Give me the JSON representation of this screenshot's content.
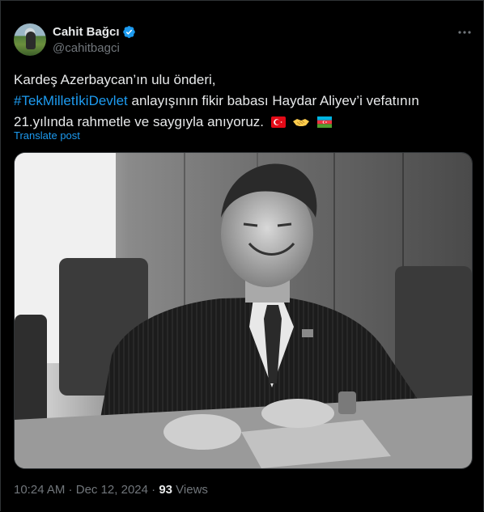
{
  "author": {
    "name": "Cahit Bağcı",
    "handle": "@cahitbagci",
    "verified": true,
    "avatar_icon": "profile-photo"
  },
  "more_icon": "more-options-icon",
  "tweet": {
    "line1": "Kardeş Azerbaycan’ın ulu önderi,",
    "hashtag": "#TekMilletİkiDevlet",
    "line2_rest": " anlayışının fikir babası Haydar Aliyev’i vefatının",
    "line3": "21.yılında rahmetle ve saygıyla anıyoruz.",
    "emojis": [
      "turkey-flag",
      "handshake",
      "azerbaijan-flag"
    ]
  },
  "translate_label": "Translate post",
  "media": {
    "kind": "black-and-white photo",
    "icon": "tweet-photo"
  },
  "footer": {
    "time": "10:24 AM",
    "separator": " · ",
    "date": "Dec 12, 2024",
    "views_count": "93",
    "views_label": "Views"
  },
  "colors": {
    "background": "#000000",
    "text": "#e7e9ea",
    "secondary": "#71767b",
    "accent": "#1d9bf0",
    "border": "#2f3336"
  }
}
